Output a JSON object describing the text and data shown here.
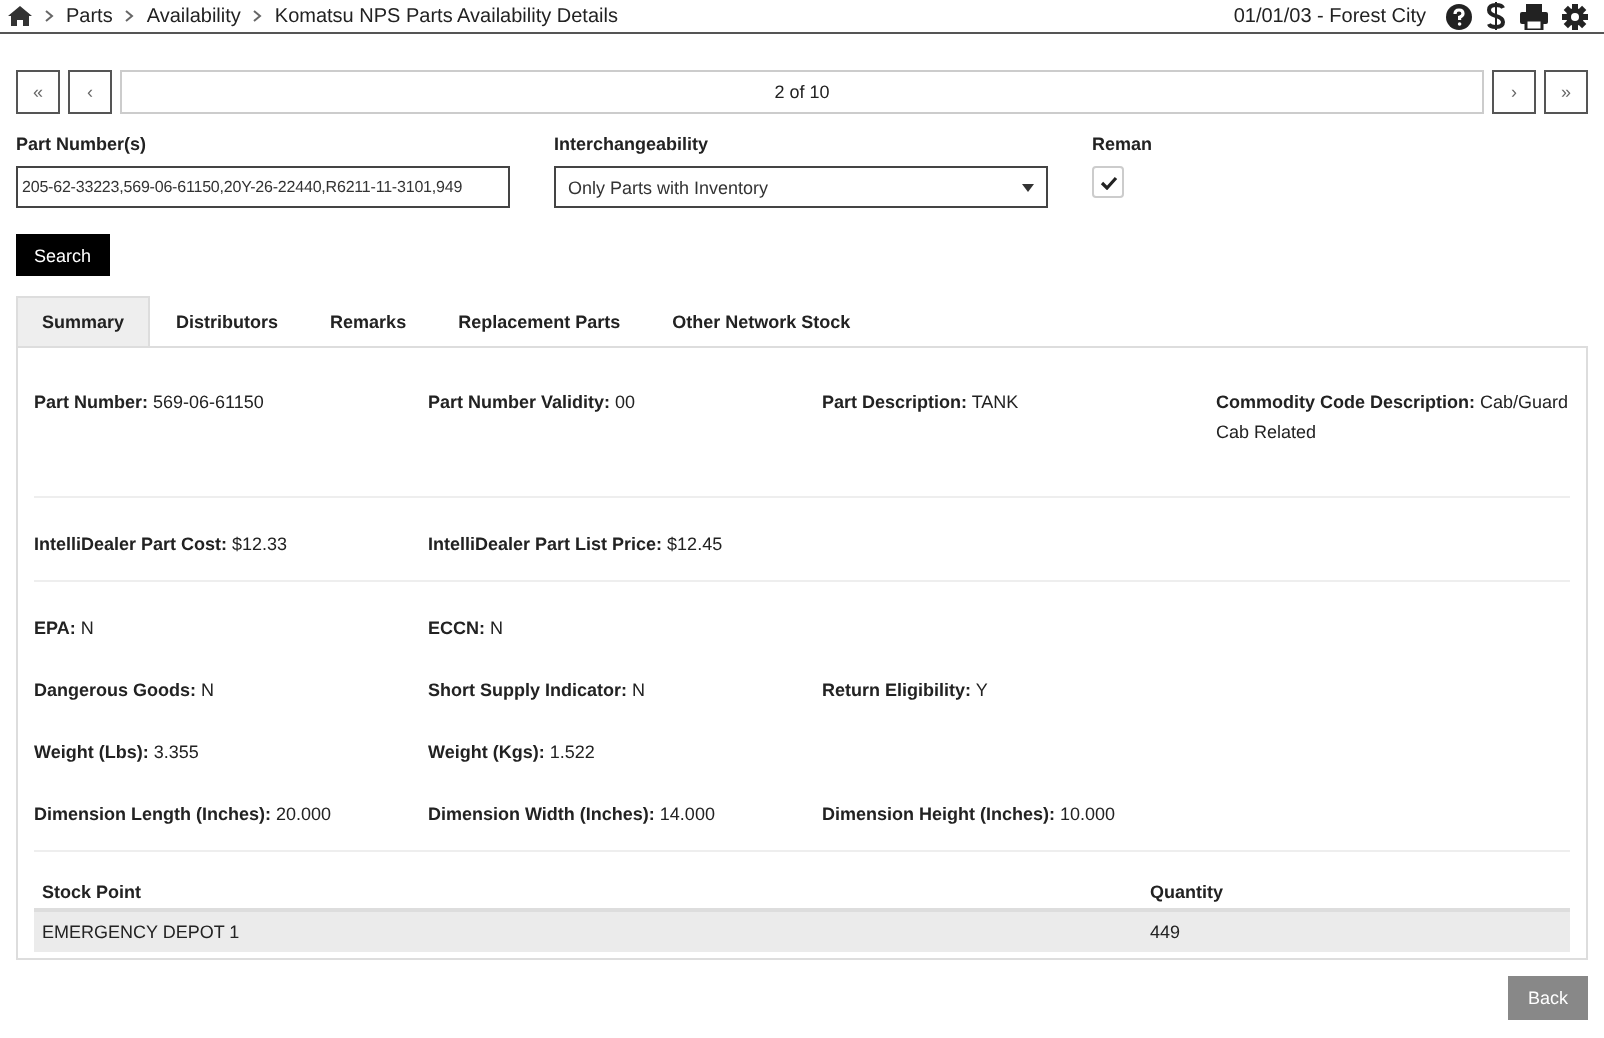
{
  "breadcrumb": [
    "Parts",
    "Availability",
    "Komatsu NPS Parts Availability Details"
  ],
  "header": {
    "location": "01/01/03 - Forest City"
  },
  "pager": {
    "first": "«",
    "prev": "‹",
    "position": "2 of 10",
    "next": "›",
    "last": "»"
  },
  "form": {
    "part_numbers": {
      "label": "Part Number(s)",
      "value": "205-62-33223,569-06-61150,20Y-26-22440,R6211-11-3101,949"
    },
    "interchangeability": {
      "label": "Interchangeability",
      "value": "Only Parts with Inventory"
    },
    "reman": {
      "label": "Reman",
      "checked": true
    },
    "search_button": "Search"
  },
  "tabs": [
    {
      "label": "Summary",
      "selected": true
    },
    {
      "label": "Distributors",
      "selected": false
    },
    {
      "label": "Remarks",
      "selected": false
    },
    {
      "label": "Replacement Parts",
      "selected": false
    },
    {
      "label": "Other Network Stock",
      "selected": false
    }
  ],
  "sections": [
    {
      "rows": [
        [
          {
            "label": "Part Number:",
            "value": "569-06-61150"
          },
          {
            "label": "Part Number Validity:",
            "value": "00"
          },
          {
            "label": "Part Description:",
            "value": "TANK"
          },
          {
            "label": "Commodity Code Description:",
            "value": "Cab/Guard Cab Related"
          }
        ]
      ]
    },
    {
      "rows": [
        [
          {
            "label": "IntelliDealer Part Cost:",
            "value": "$12.33"
          },
          {
            "label": "IntelliDealer Part List Price:",
            "value": "$12.45"
          }
        ]
      ]
    },
    {
      "rows": [
        [
          {
            "label": "EPA:",
            "value": "N"
          },
          {
            "label": "ECCN:",
            "value": "N"
          }
        ],
        [
          {
            "label": "Dangerous Goods:",
            "value": "N"
          },
          {
            "label": "Short Supply Indicator:",
            "value": "N"
          },
          {
            "label": "Return Eligibility:",
            "value": "Y"
          }
        ],
        [
          {
            "label": "Weight (Lbs):",
            "value": "3.355"
          },
          {
            "label": "Weight (Kgs):",
            "value": "1.522"
          }
        ],
        [
          {
            "label": "Dimension Length (Inches):",
            "value": "20.000"
          },
          {
            "label": "Dimension Width (Inches):",
            "value": "14.000"
          },
          {
            "label": "Dimension Height (Inches):",
            "value": "10.000"
          }
        ]
      ]
    }
  ],
  "stock_table": {
    "columns": [
      "Stock Point",
      "Quantity"
    ],
    "rows": [
      [
        "EMERGENCY DEPOT 1",
        "449"
      ]
    ]
  },
  "back_button": "Back"
}
